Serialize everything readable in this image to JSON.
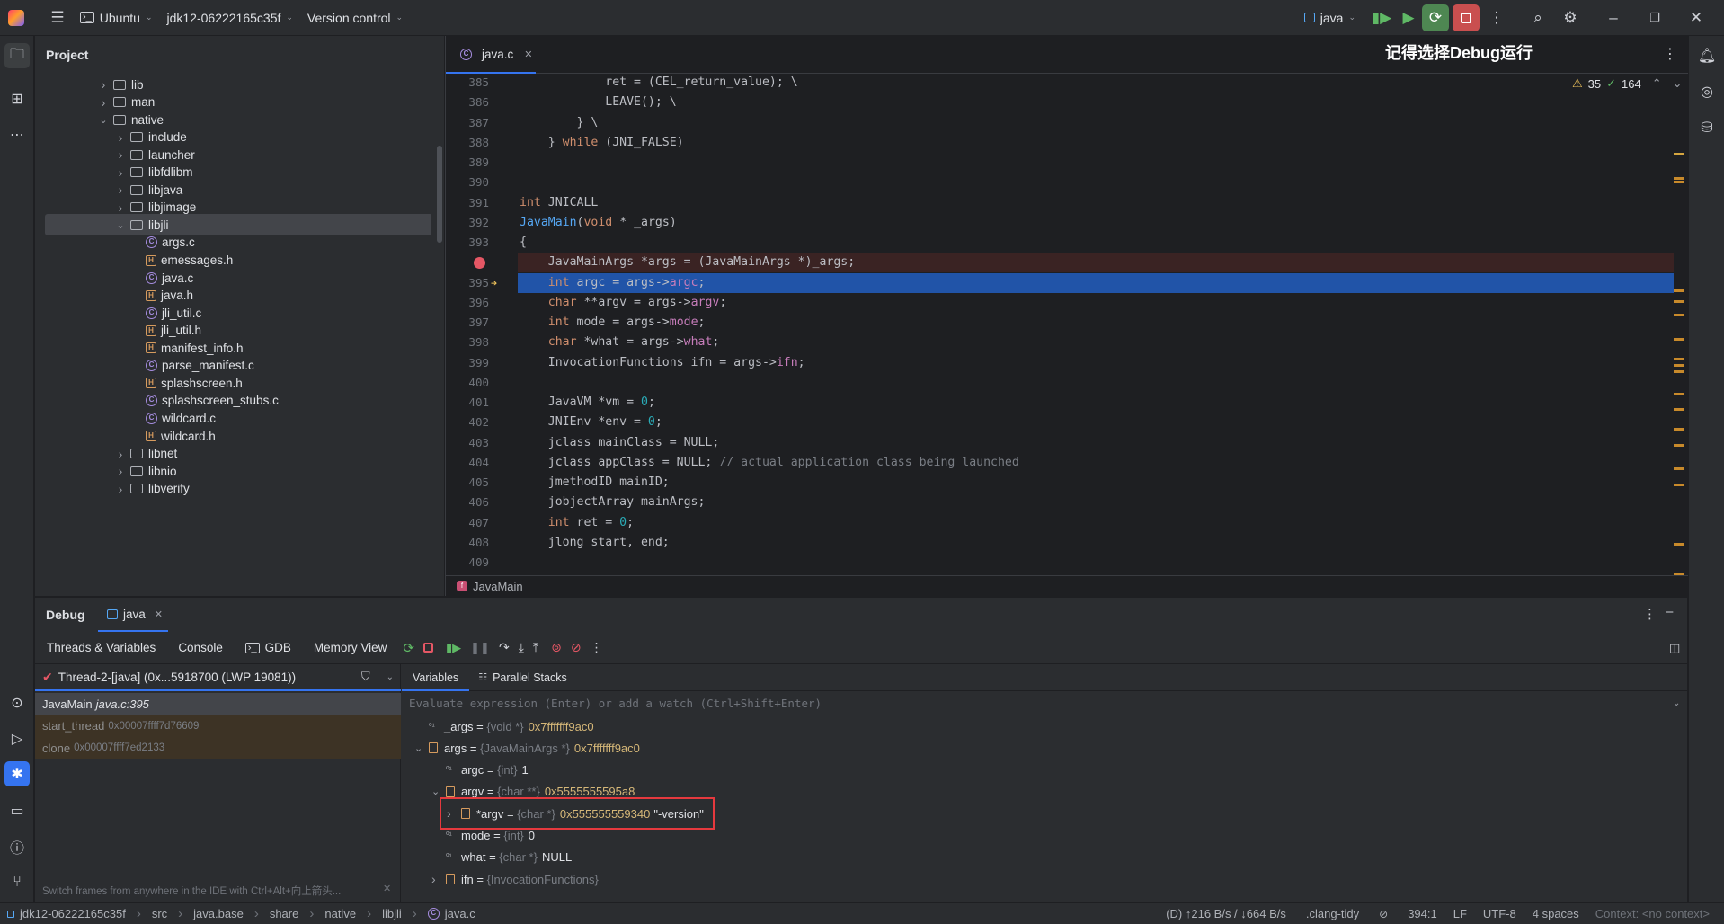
{
  "titlebar": {
    "project_switch": "Ubuntu",
    "branch": "jdk12-06222165c35f",
    "vcs": "Version control",
    "run_config": "java"
  },
  "project_panel": {
    "title": "Project",
    "tree": [
      {
        "label": "lib",
        "kind": "folder",
        "depth": 1,
        "expanded": false
      },
      {
        "label": "man",
        "kind": "folder",
        "depth": 1,
        "expanded": false
      },
      {
        "label": "native",
        "kind": "folder",
        "depth": 1,
        "expanded": true
      },
      {
        "label": "include",
        "kind": "folder",
        "depth": 2,
        "expanded": false
      },
      {
        "label": "launcher",
        "kind": "folder",
        "depth": 2,
        "expanded": false
      },
      {
        "label": "libfdlibm",
        "kind": "folder",
        "depth": 2,
        "expanded": false
      },
      {
        "label": "libjava",
        "kind": "folder",
        "depth": 2,
        "expanded": false
      },
      {
        "label": "libjimage",
        "kind": "folder",
        "depth": 2,
        "expanded": false
      },
      {
        "label": "libjli",
        "kind": "folder",
        "depth": 2,
        "expanded": true,
        "selected": true
      },
      {
        "label": "args.c",
        "kind": "c",
        "depth": 3
      },
      {
        "label": "emessages.h",
        "kind": "h",
        "depth": 3
      },
      {
        "label": "java.c",
        "kind": "c",
        "depth": 3
      },
      {
        "label": "java.h",
        "kind": "h",
        "depth": 3
      },
      {
        "label": "jli_util.c",
        "kind": "c",
        "depth": 3
      },
      {
        "label": "jli_util.h",
        "kind": "h",
        "depth": 3
      },
      {
        "label": "manifest_info.h",
        "kind": "h",
        "depth": 3
      },
      {
        "label": "parse_manifest.c",
        "kind": "c",
        "depth": 3
      },
      {
        "label": "splashscreen.h",
        "kind": "h",
        "depth": 3
      },
      {
        "label": "splashscreen_stubs.c",
        "kind": "c",
        "depth": 3
      },
      {
        "label": "wildcard.c",
        "kind": "c",
        "depth": 3
      },
      {
        "label": "wildcard.h",
        "kind": "h",
        "depth": 3
      },
      {
        "label": "libnet",
        "kind": "folder",
        "depth": 2,
        "expanded": false
      },
      {
        "label": "libnio",
        "kind": "folder",
        "depth": 2,
        "expanded": false
      },
      {
        "label": "libverify",
        "kind": "folder",
        "depth": 2,
        "expanded": false
      }
    ]
  },
  "editor": {
    "tab_label": "java.c",
    "annotation": "记得选择Debug运行",
    "warnings": "35",
    "checks": "164",
    "breadcrumb": "JavaMain",
    "lines": [
      {
        "n": "385",
        "html": "            ret = (CEL_return_value); \\"
      },
      {
        "n": "386",
        "html": "            LEAVE(); \\"
      },
      {
        "n": "387",
        "html": "        } \\"
      },
      {
        "n": "388",
        "html": "    } <span class=\"kw\">while</span> (JNI_FALSE)"
      },
      {
        "n": "389",
        "html": ""
      },
      {
        "n": "390",
        "html": ""
      },
      {
        "n": "391",
        "html": "<span class=\"kw\">int</span> JNICALL"
      },
      {
        "n": "392",
        "html": "<span class=\"fn\">JavaMain</span>(<span class=\"kw\">void</span> * _args)"
      },
      {
        "n": "393",
        "html": "{"
      },
      {
        "n": "",
        "html": "    JavaMainArgs *args = (JavaMainArgs *)_args;",
        "breakpoint": true
      },
      {
        "n": "395",
        "html": "    <span class=\"kw\">int</span> argc = args-><span class=\"fld\">argc</span>;",
        "current": true
      },
      {
        "n": "396",
        "html": "    <span class=\"kw\">char</span> **argv = args-><span class=\"fld\">argv</span>;"
      },
      {
        "n": "397",
        "html": "    <span class=\"kw\">int</span> mode = args-><span class=\"fld\">mode</span>;"
      },
      {
        "n": "398",
        "html": "    <span class=\"kw\">char</span> *what = args-><span class=\"fld\">what</span>;"
      },
      {
        "n": "399",
        "html": "    InvocationFunctions ifn = args-><span class=\"fld\">ifn</span>;"
      },
      {
        "n": "400",
        "html": ""
      },
      {
        "n": "401",
        "html": "    JavaVM *vm = <span class=\"num\">0</span>;"
      },
      {
        "n": "402",
        "html": "    JNIEnv *env = <span class=\"num\">0</span>;"
      },
      {
        "n": "403",
        "html": "    jclass mainClass = NULL;"
      },
      {
        "n": "404",
        "html": "    jclass appClass = NULL; <span class=\"cmt\">// actual application class being launched</span>"
      },
      {
        "n": "405",
        "html": "    jmethodID mainID;"
      },
      {
        "n": "406",
        "html": "    jobjectArray mainArgs;"
      },
      {
        "n": "407",
        "html": "    <span class=\"kw\">int</span> ret = <span class=\"num\">0</span>;"
      },
      {
        "n": "408",
        "html": "    jlong start, end;"
      },
      {
        "n": "409",
        "html": ""
      }
    ]
  },
  "debug": {
    "title": "Debug",
    "session_tab": "java",
    "tabs": [
      "Threads & Variables",
      "Console",
      "GDB",
      "Memory View"
    ],
    "thread_selector": "Thread-2-[java] (0x...5918700 (LWP 19081))",
    "frames": [
      {
        "fn": "JavaMain",
        "loc": "java.c:395",
        "current": true
      },
      {
        "fn": "start_thread",
        "loc": "0x00007ffff7d76609"
      },
      {
        "fn": "clone",
        "loc": "0x00007ffff7ed2133"
      }
    ],
    "frames_hint": "Switch frames from anywhere in the IDE with Ctrl+Alt+向上箭头...",
    "var_tabs": [
      "Variables",
      "Parallel Stacks"
    ],
    "eval_placeholder": "Evaluate expression (Enter) or add a watch (Ctrl+Shift+Enter)",
    "variables": [
      {
        "name": "_args",
        "type": "{void *}",
        "value": "0x7fffffff9ac0",
        "depth": 0,
        "arrow": "",
        "icon": "field"
      },
      {
        "name": "args",
        "type": "{JavaMainArgs *}",
        "value": "0x7fffffff9ac0",
        "depth": 0,
        "arrow": "open",
        "icon": "struct"
      },
      {
        "name": "argc",
        "type": "{int}",
        "value": "1",
        "depth": 1,
        "arrow": "",
        "icon": "field"
      },
      {
        "name": "argv",
        "type": "{char **}",
        "value": "0x5555555595a8",
        "depth": 1,
        "arrow": "open",
        "icon": "struct"
      },
      {
        "name": "*argv",
        "type": "{char *}",
        "value": "0x555555559340",
        "str": "\"-version\"",
        "depth": 2,
        "arrow": "closed",
        "icon": "struct",
        "highlight": true
      },
      {
        "name": "mode",
        "type": "{int}",
        "value": "0",
        "depth": 1,
        "arrow": "",
        "icon": "field"
      },
      {
        "name": "what",
        "type": "{char *}",
        "value": "NULL",
        "depth": 1,
        "arrow": "",
        "icon": "field"
      },
      {
        "name": "ifn",
        "type": "{InvocationFunctions}",
        "value": "",
        "depth": 1,
        "arrow": "closed",
        "icon": "struct"
      }
    ]
  },
  "statusbar": {
    "path": [
      "jdk12-06222165c35f",
      "src",
      "java.base",
      "share",
      "native",
      "libjli",
      "java.c"
    ],
    "io": "(D) ↑216 B/s / ↓664 B/s",
    "linter": ".clang-tidy",
    "position": "394:1",
    "line_ending": "LF",
    "encoding": "UTF-8",
    "indent": "4 spaces",
    "context": "Context: <no context>"
  }
}
